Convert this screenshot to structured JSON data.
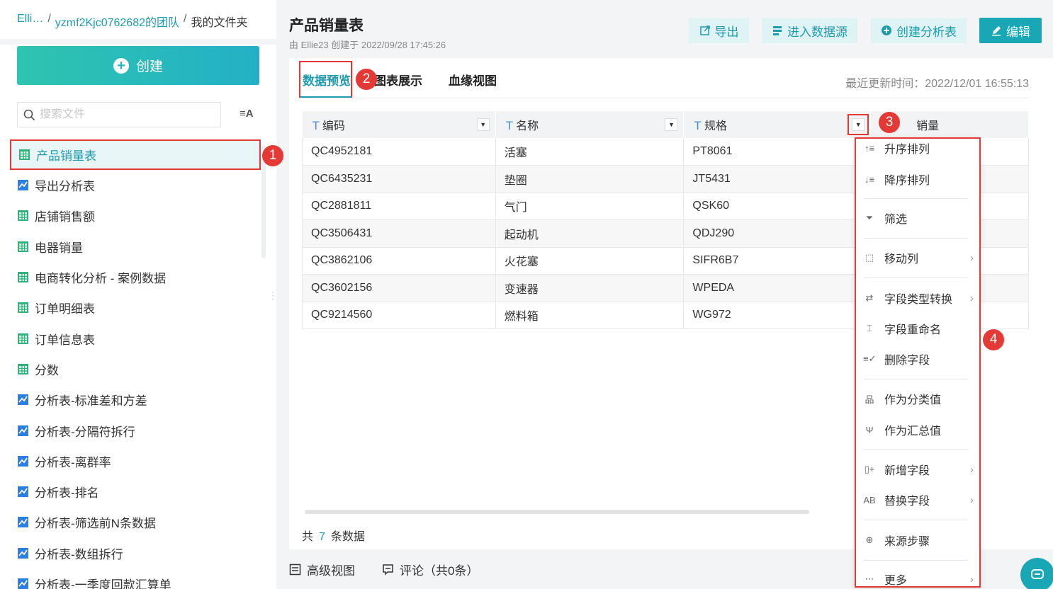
{
  "breadcrumb": {
    "root": "Elli…",
    "sep": "/",
    "team": "yzmf2Kjc0762682的团队",
    "current": "我的文件夹"
  },
  "sidebar": {
    "create_label": "创建",
    "search_placeholder": "搜索文件",
    "sort_label": "≡A",
    "items": [
      {
        "label": "产品销量表",
        "icon": "table-icon"
      },
      {
        "label": "导出分析表",
        "icon": "chart-icon"
      },
      {
        "label": "店铺销售额",
        "icon": "table-icon"
      },
      {
        "label": "电器销量",
        "icon": "table-icon"
      },
      {
        "label": "电商转化分析 - 案例数据",
        "icon": "table-icon"
      },
      {
        "label": "订单明细表",
        "icon": "table-icon"
      },
      {
        "label": "订单信息表",
        "icon": "table-icon"
      },
      {
        "label": "分数",
        "icon": "table-icon"
      },
      {
        "label": "分析表-标准差和方差",
        "icon": "chart-icon"
      },
      {
        "label": "分析表-分隔符拆行",
        "icon": "chart-icon"
      },
      {
        "label": "分析表-离群率",
        "icon": "chart-icon"
      },
      {
        "label": "分析表-排名",
        "icon": "chart-icon"
      },
      {
        "label": "分析表-筛选前N条数据",
        "icon": "chart-icon"
      },
      {
        "label": "分析表-数组拆行",
        "icon": "chart-icon"
      },
      {
        "label": "分析表-一季度回款汇算单",
        "icon": "chart-icon"
      }
    ]
  },
  "header": {
    "title": "产品销量表",
    "subtitle": "由 Ellie23 创建于 2022/09/28 17:45:26",
    "export_label": "导出",
    "datasource_label": "进入数据源",
    "create_analysis_label": "创建分析表",
    "edit_label": "编辑"
  },
  "tabs": {
    "preview": "数据预览",
    "chart": "图表展示",
    "lineage": "血缘视图"
  },
  "update_time": "最近更新时间：2022/12/01 16:55:13",
  "table": {
    "type_icon": "T",
    "columns": [
      "编码",
      "名称",
      "规格",
      "销量"
    ],
    "rows": [
      [
        "QC4952181",
        "活塞",
        "PT8061"
      ],
      [
        "QC6435231",
        "垫圈",
        "JT5431"
      ],
      [
        "QC2881811",
        "气门",
        "QSK60"
      ],
      [
        "QC3506431",
        "起动机",
        "QDJ290"
      ],
      [
        "QC3862106",
        "火花塞",
        "SIFR6B7"
      ],
      [
        "QC3602156",
        "变速器",
        "WPEDA"
      ],
      [
        "QC9214560",
        "燃料箱",
        "WG972"
      ]
    ]
  },
  "total": {
    "prefix": "共",
    "count": "7",
    "suffix": "条数据"
  },
  "bottom": {
    "advanced_view": "高级视图",
    "comments": "评论（共0条）"
  },
  "menu": {
    "asc": "升序排列",
    "desc": "降序排列",
    "filter": "筛选",
    "move_col": "移动列",
    "type_convert": "字段类型转换",
    "rename": "字段重命名",
    "delete": "删除字段",
    "as_category": "作为分类值",
    "as_summary": "作为汇总值",
    "add_field": "新增字段",
    "replace_field": "替换字段",
    "source_step": "来源步骤",
    "more": "更多"
  },
  "badges": [
    "1",
    "2",
    "3",
    "4"
  ],
  "colors": {
    "accent": "#1aa7b5",
    "highlight": "#e53935",
    "link": "#1f9bb0"
  }
}
